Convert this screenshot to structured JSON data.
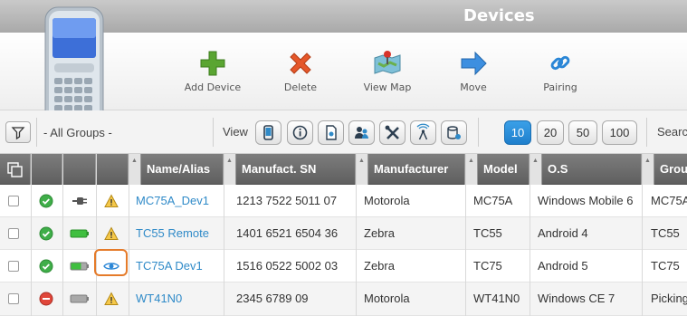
{
  "window": {
    "title": "Devices"
  },
  "toolbar": {
    "add_device": "Add Device",
    "delete": "Delete",
    "view_map": "View Map",
    "move": "Move",
    "pairing": "Pairing"
  },
  "filters": {
    "groups": "- All Groups -",
    "view_label": "View",
    "view_icons": [
      "phone-icon",
      "info-icon",
      "document-icon",
      "users-icon",
      "tools-icon",
      "antenna-icon",
      "database-icon"
    ],
    "page_sizes": [
      "10",
      "20",
      "50",
      "100"
    ],
    "active_page_size": "10",
    "search_label": "Searc"
  },
  "table": {
    "columns": [
      "Name/Alias",
      "Manufact. SN",
      "Manufacturer",
      "Model",
      "O.S",
      "Grou"
    ],
    "rows": [
      {
        "status": "ok",
        "power": "plug",
        "alert": "warning",
        "name": "MC75A_Dev1",
        "sn": "1213 7522 5011 07",
        "manufacturer": "Motorola",
        "model": "MC75A",
        "os": "Windows Mobile 6",
        "group": "MC75A"
      },
      {
        "status": "ok",
        "power": "battery-full",
        "alert": "warning",
        "name": "TC55 Remote",
        "sn": "1401 6521 6504 36",
        "manufacturer": "Zebra",
        "model": "TC55",
        "os": "Android 4",
        "group": "TC55"
      },
      {
        "status": "ok",
        "power": "battery-medium",
        "alert": "eye",
        "name": "TC75A Dev1",
        "sn": "1516 0522 5002 03",
        "manufacturer": "Zebra",
        "model": "TC75",
        "os": "Android 5",
        "group": "TC75"
      },
      {
        "status": "blocked",
        "power": "battery-empty",
        "alert": "warning",
        "name": "WT41N0",
        "sn": "2345 6789 09",
        "manufacturer": "Motorola",
        "model": "WT41N0",
        "os": "Windows CE 7",
        "group": "Picking"
      }
    ]
  },
  "colors": {
    "accent": "#2f8ac8",
    "active_page": "#1f7fcc",
    "highlight": "#e57b2a",
    "ok": "#3fae49",
    "blocked": "#e0463a",
    "battery": "#3fbf3f"
  }
}
